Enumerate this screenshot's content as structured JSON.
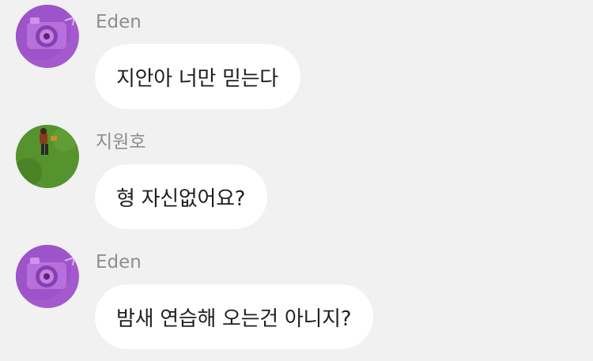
{
  "messages": [
    {
      "sender": "Eden",
      "text": "지안아 너만 믿는다",
      "avatar_icon": "camera-icon"
    },
    {
      "sender": "지원호",
      "text": "형 자신없어요?",
      "avatar_icon": "grass-photo"
    },
    {
      "sender": "Eden",
      "text": "밤새 연습해 오는건 아니지?",
      "avatar_icon": "camera-icon"
    }
  ],
  "colors": {
    "background": "#f1f1f1",
    "bubble": "#ffffff",
    "sender_text": "#8e8e8e",
    "message_text": "#1f1f1f",
    "camera_avatar": "#a65ccf",
    "grass_avatar": "#4f8a2a"
  }
}
